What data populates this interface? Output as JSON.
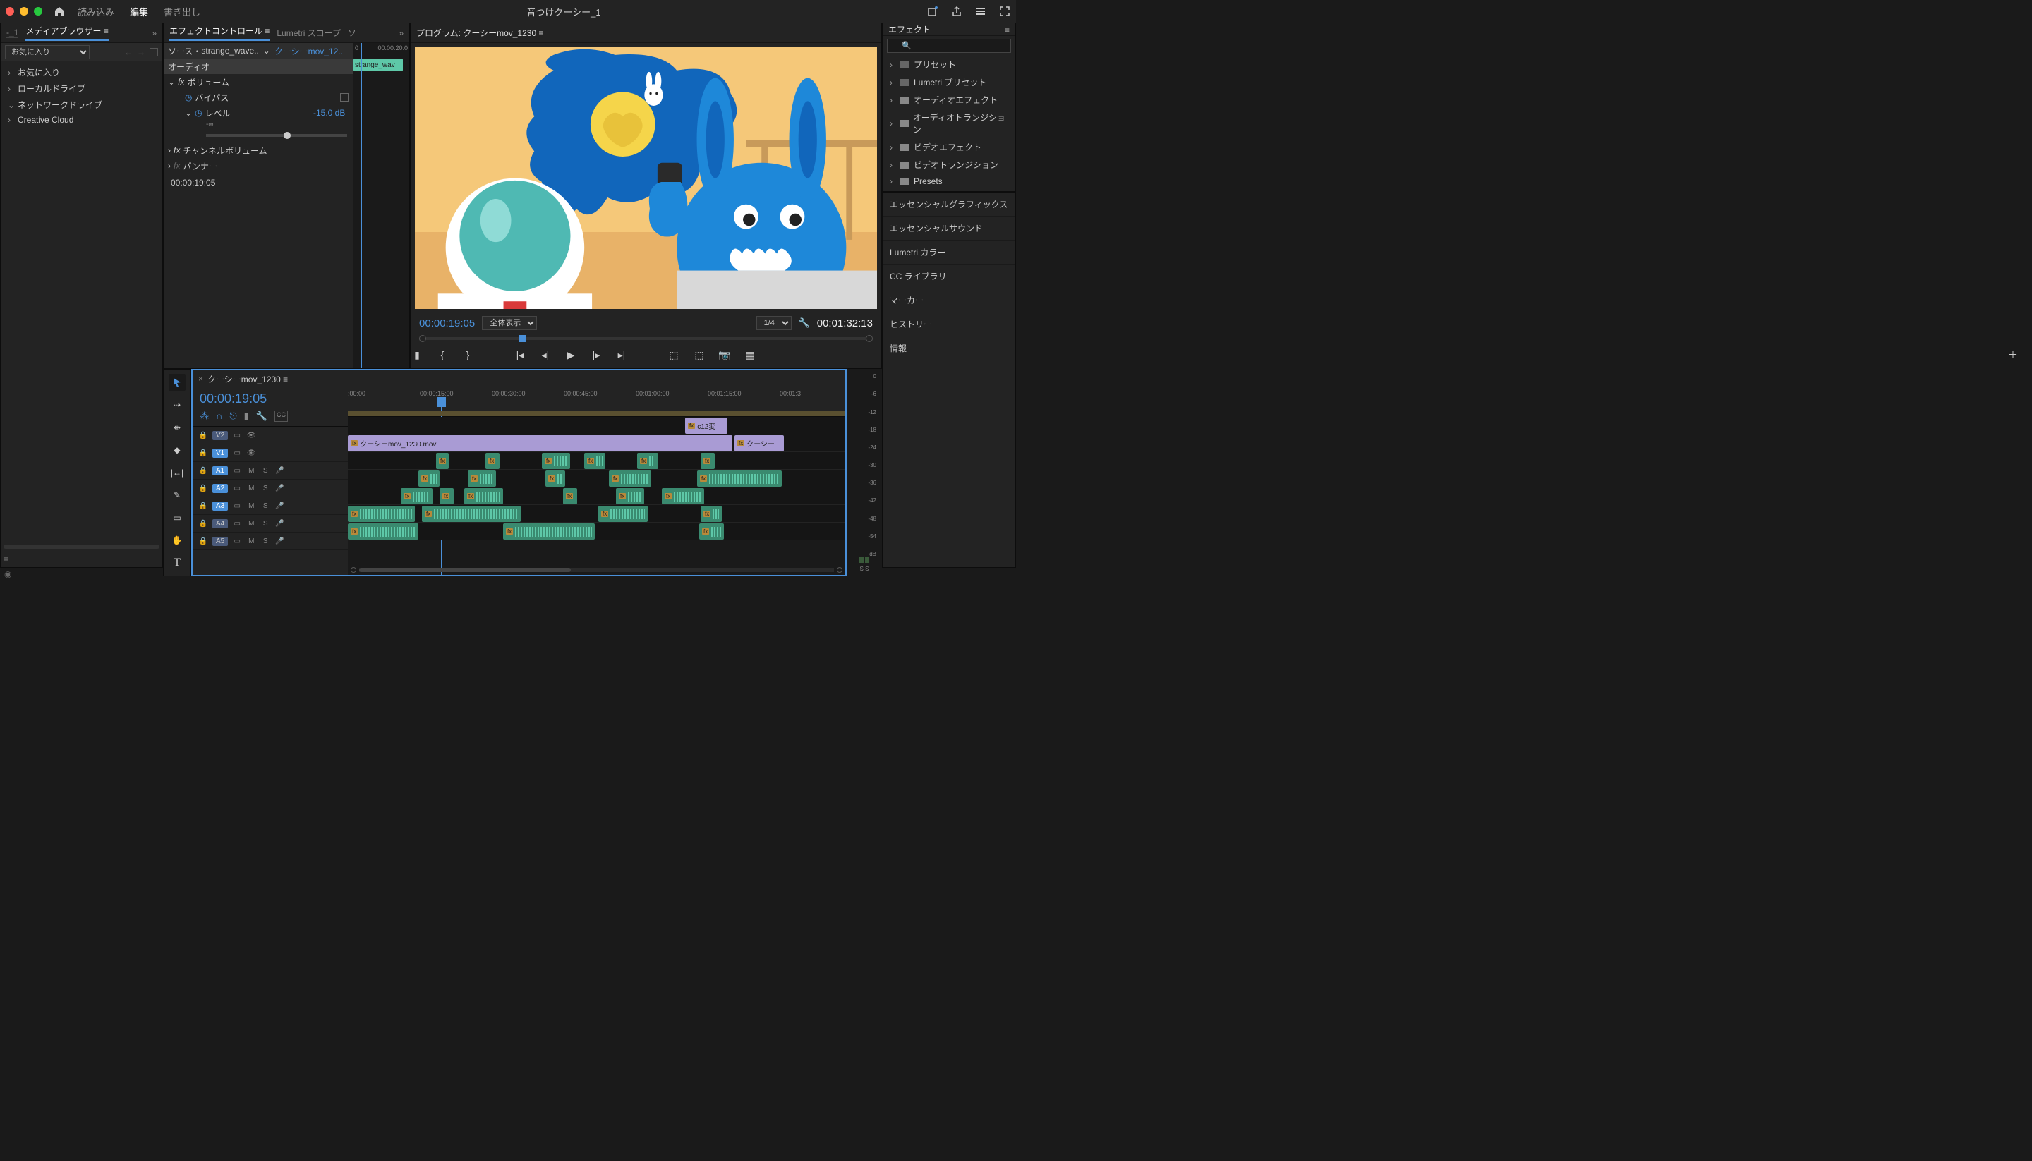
{
  "top": {
    "menu": [
      "読み込み",
      "編集",
      "書き出し"
    ],
    "menu_active": 1,
    "title": "音つけクーシー_1"
  },
  "mediaBrowser": {
    "tab": "メディアブラウザー",
    "prefix": "-_1",
    "favorites_label": "お気に入り",
    "items": [
      {
        "label": "お気に入り",
        "chev": "›"
      },
      {
        "label": "ローカルドライブ",
        "chev": "›"
      },
      {
        "label": "ネットワークドライブ",
        "chev": "⌄"
      },
      {
        "label": "Creative Cloud",
        "chev": "›"
      }
    ]
  },
  "effectControls": {
    "tabs": [
      "エフェクトコントロール",
      "Lumetri スコープ",
      "ソ"
    ],
    "src_prefix": "ソース・",
    "src": "strange_wave..",
    "linked": "クーシーmov_12..",
    "audio": "オーディオ",
    "volume": "ボリューム",
    "bypass": "バイパス",
    "level": "レベル",
    "level_value": "-15.0 dB",
    "slider_min": "-∞",
    "slider_max": "15.0",
    "channel_volume": "チャンネルボリューム",
    "panner": "パンナー",
    "fx": "fx",
    "mini_clip": "strange_wav",
    "mini_tc_a": "0",
    "mini_tc_b": "00:00:20:0",
    "src_tc": "00:00:19:05"
  },
  "program": {
    "tab_prefix": "プログラム: ",
    "tab": "クーシーmov_1230",
    "tc_left": "00:00:19:05",
    "fit": "全体表示",
    "res": "1/4",
    "tc_right": "00:01:32:13"
  },
  "effects": {
    "tab": "エフェクト",
    "items": [
      "プリセット",
      "Lumetri プリセット",
      "オーディオエフェクト",
      "オーディオトランジション",
      "ビデオエフェクト",
      "ビデオトランジション",
      "Presets"
    ]
  },
  "rightPanels": [
    "エッセンシャルグラフィックス",
    "エッセンシャルサウンド",
    "Lumetri カラー",
    "CC ライブラリ",
    "マーカー",
    "ヒストリー",
    "情報"
  ],
  "timeline": {
    "seq": "クーシーmov_1230",
    "tc": "00:00:19:05",
    "ruler": [
      ":00:00",
      "00:00:15:00",
      "00:00:30:00",
      "00:00:45:00",
      "00:01:00:00",
      "00:01:15:00",
      "00:01:3"
    ],
    "tracks": [
      {
        "name": "V2",
        "type": "v",
        "on": false
      },
      {
        "name": "V1",
        "type": "v",
        "on": true
      },
      {
        "name": "A1",
        "type": "a",
        "on": true
      },
      {
        "name": "A2",
        "type": "a",
        "on": true
      },
      {
        "name": "A3",
        "type": "a",
        "on": true
      },
      {
        "name": "A4",
        "type": "a",
        "on": false
      },
      {
        "name": "A5",
        "type": "a",
        "on": false
      }
    ],
    "v2_clip": "c12変",
    "v1_clip": "クーシーmov_1230.mov",
    "v1_clip_b": "クーシー"
  },
  "meters": {
    "ticks": [
      "0",
      "-6",
      "-12",
      "-18",
      "-24",
      "-30",
      "-36",
      "-42",
      "-48",
      "-54",
      "dB"
    ],
    "solo": "S"
  }
}
